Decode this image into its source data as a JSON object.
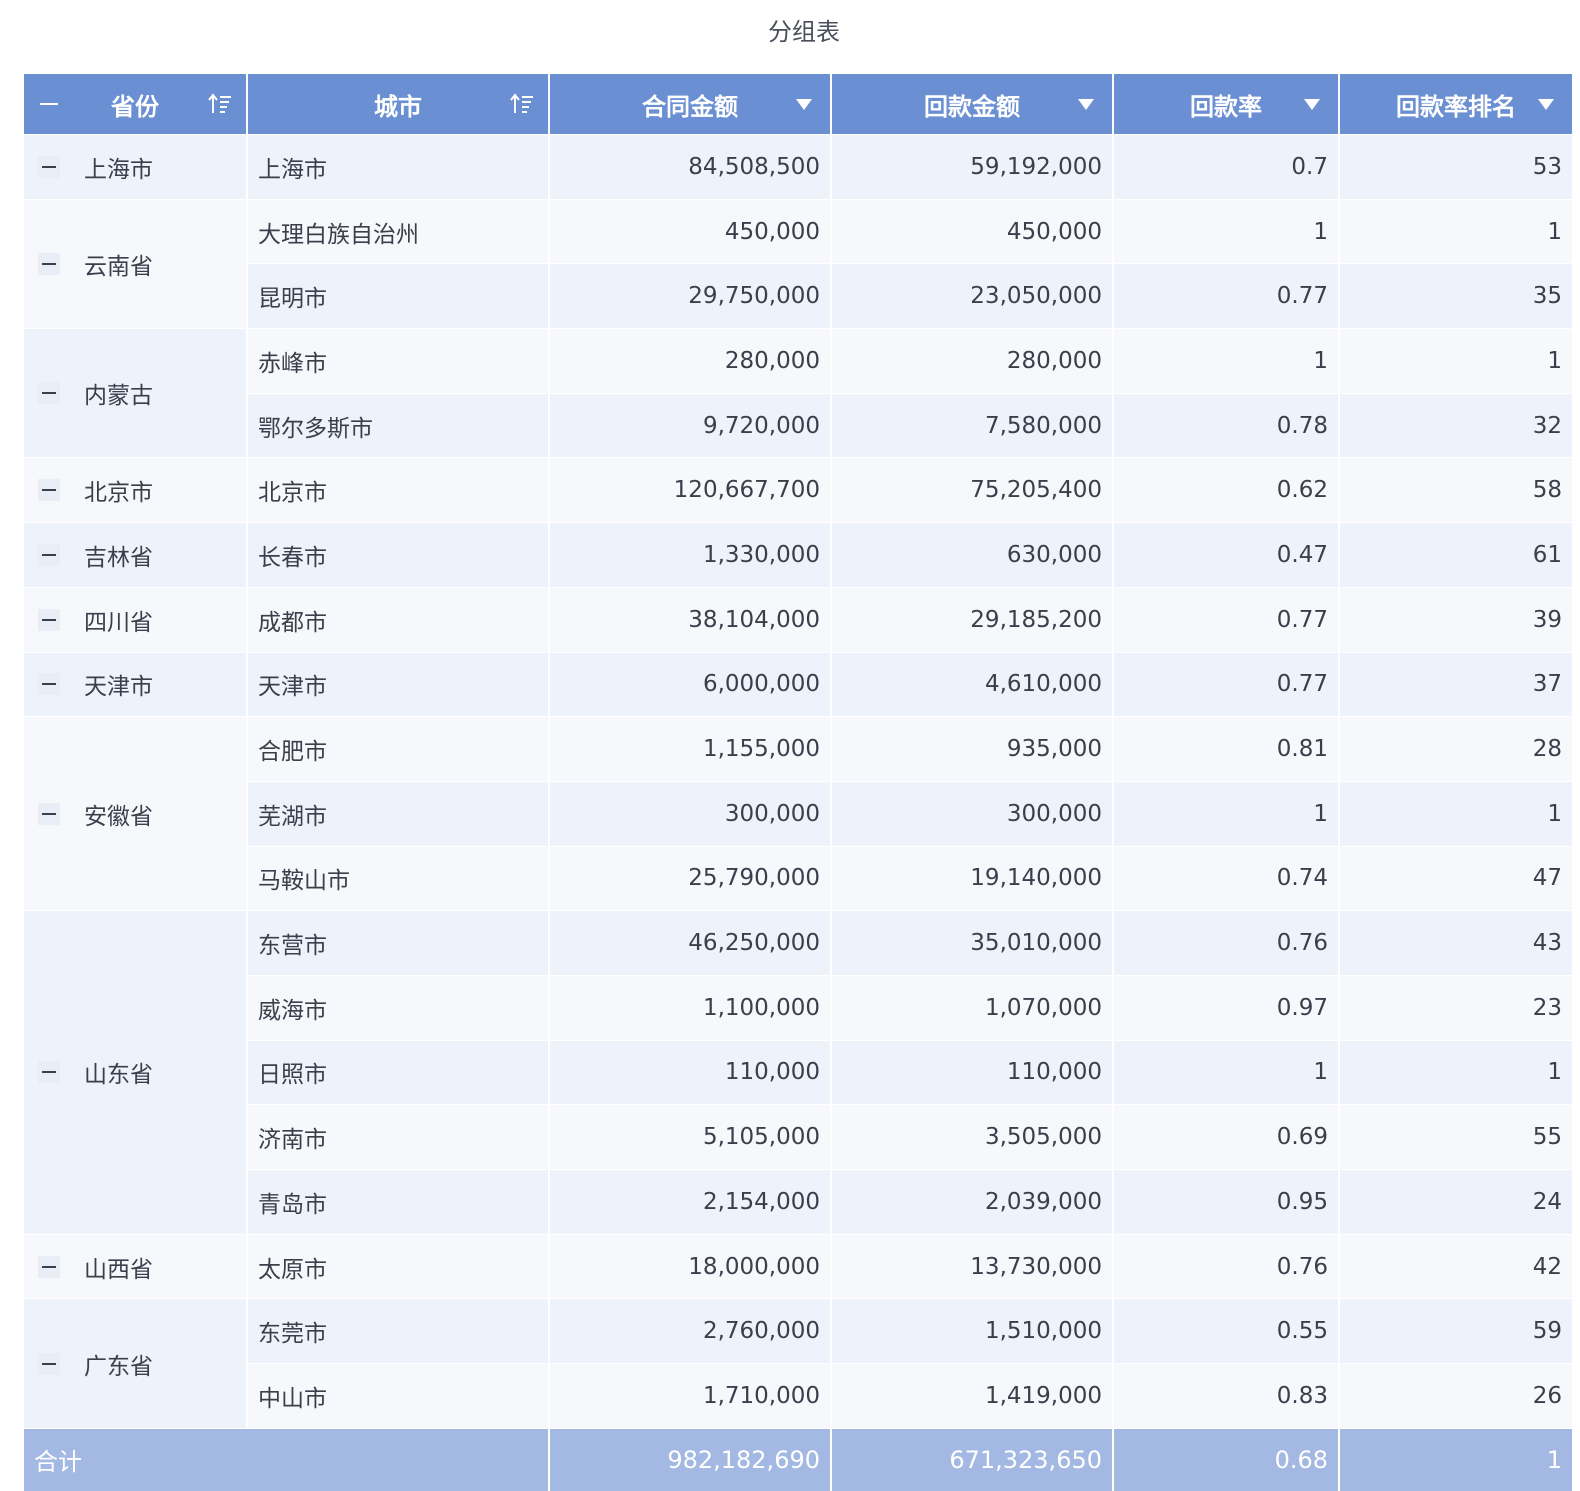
{
  "title": "分组表",
  "header": {
    "province": "省份",
    "city": "城市",
    "contract": "合同金额",
    "payment": "回款金额",
    "rate": "回款率",
    "rank": "回款率排名"
  },
  "groups": [
    {
      "province": "上海市",
      "rows": [
        {
          "city": "上海市",
          "contract": "84,508,500",
          "payment": "59,192,000",
          "rate": "0.7",
          "rank": "53"
        }
      ]
    },
    {
      "province": "云南省",
      "rows": [
        {
          "city": "大理白族自治州",
          "contract": "450,000",
          "payment": "450,000",
          "rate": "1",
          "rank": "1"
        },
        {
          "city": "昆明市",
          "contract": "29,750,000",
          "payment": "23,050,000",
          "rate": "0.77",
          "rank": "35"
        }
      ]
    },
    {
      "province": "内蒙古",
      "rows": [
        {
          "city": "赤峰市",
          "contract": "280,000",
          "payment": "280,000",
          "rate": "1",
          "rank": "1"
        },
        {
          "city": "鄂尔多斯市",
          "contract": "9,720,000",
          "payment": "7,580,000",
          "rate": "0.78",
          "rank": "32"
        }
      ]
    },
    {
      "province": "北京市",
      "rows": [
        {
          "city": "北京市",
          "contract": "120,667,700",
          "payment": "75,205,400",
          "rate": "0.62",
          "rank": "58"
        }
      ]
    },
    {
      "province": "吉林省",
      "rows": [
        {
          "city": "长春市",
          "contract": "1,330,000",
          "payment": "630,000",
          "rate": "0.47",
          "rank": "61"
        }
      ]
    },
    {
      "province": "四川省",
      "rows": [
        {
          "city": "成都市",
          "contract": "38,104,000",
          "payment": "29,185,200",
          "rate": "0.77",
          "rank": "39"
        }
      ]
    },
    {
      "province": "天津市",
      "rows": [
        {
          "city": "天津市",
          "contract": "6,000,000",
          "payment": "4,610,000",
          "rate": "0.77",
          "rank": "37"
        }
      ]
    },
    {
      "province": "安徽省",
      "rows": [
        {
          "city": "合肥市",
          "contract": "1,155,000",
          "payment": "935,000",
          "rate": "0.81",
          "rank": "28"
        },
        {
          "city": "芜湖市",
          "contract": "300,000",
          "payment": "300,000",
          "rate": "1",
          "rank": "1"
        },
        {
          "city": "马鞍山市",
          "contract": "25,790,000",
          "payment": "19,140,000",
          "rate": "0.74",
          "rank": "47"
        }
      ]
    },
    {
      "province": "山东省",
      "rows": [
        {
          "city": "东营市",
          "contract": "46,250,000",
          "payment": "35,010,000",
          "rate": "0.76",
          "rank": "43"
        },
        {
          "city": "威海市",
          "contract": "1,100,000",
          "payment": "1,070,000",
          "rate": "0.97",
          "rank": "23"
        },
        {
          "city": "日照市",
          "contract": "110,000",
          "payment": "110,000",
          "rate": "1",
          "rank": "1"
        },
        {
          "city": "济南市",
          "contract": "5,105,000",
          "payment": "3,505,000",
          "rate": "0.69",
          "rank": "55"
        },
        {
          "city": "青岛市",
          "contract": "2,154,000",
          "payment": "2,039,000",
          "rate": "0.95",
          "rank": "24"
        }
      ]
    },
    {
      "province": "山西省",
      "rows": [
        {
          "city": "太原市",
          "contract": "18,000,000",
          "payment": "13,730,000",
          "rate": "0.76",
          "rank": "42"
        }
      ]
    },
    {
      "province": "广东省",
      "rows": [
        {
          "city": "东莞市",
          "contract": "2,760,000",
          "payment": "1,510,000",
          "rate": "0.55",
          "rank": "59"
        },
        {
          "city": "中山市",
          "contract": "1,710,000",
          "payment": "1,419,000",
          "rate": "0.83",
          "rank": "26"
        }
      ]
    }
  ],
  "total": {
    "label": "合计",
    "contract": "982,182,690",
    "payment": "671,323,650",
    "rate": "0.68",
    "rank": "1"
  }
}
